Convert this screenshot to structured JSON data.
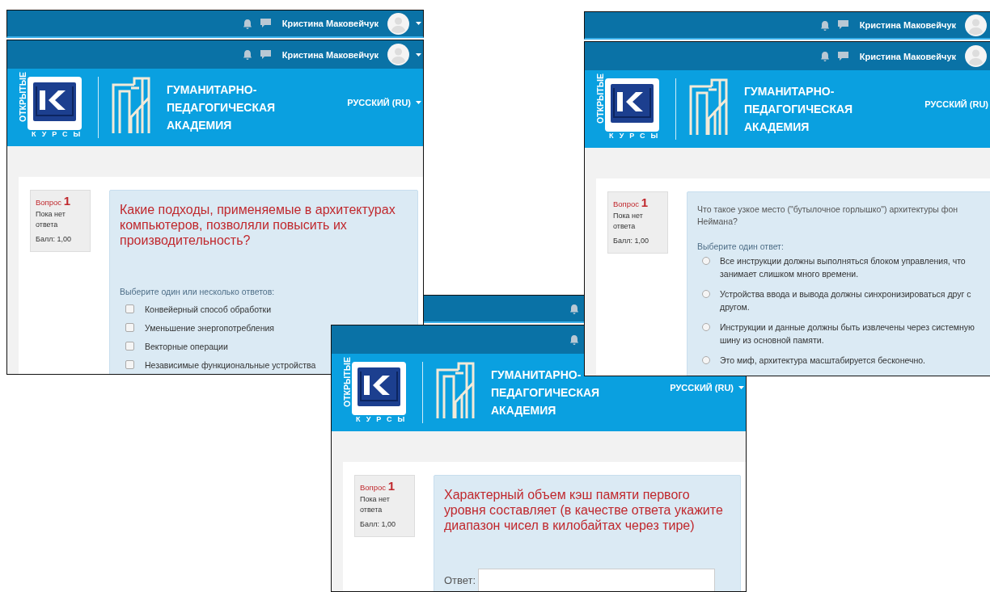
{
  "windows": [
    {
      "back_bar": {
        "user": "Кристина Маковейчук"
      },
      "top_bar": {
        "user": "Кристина Маковейчук"
      },
      "logo": {
        "vertical_word": "ОТКРЫТЫЕ",
        "bottom_word": "КУРСЫ"
      },
      "academy": [
        "ГУМАНИТАРНО-",
        "ПЕДАГОГИЧЕСКАЯ",
        "АКАДЕМИЯ"
      ],
      "language": "РУССКИЙ (RU)",
      "info": {
        "label": "Вопрос",
        "number": "1",
        "state": "Пока нет ответа",
        "grade": "Балл: 1,00"
      },
      "question": {
        "highlighted": true,
        "text": "Какие подходы, применяемые в архитектурах компьютеров, позволяли повысить их производительность?",
        "kind": "multi",
        "prompt": "Выберите один или несколько ответов:",
        "options": [
          {
            "label": "Конвейерный способ обработки",
            "checked": false
          },
          {
            "label": "Уменьшение энергопотребления",
            "checked": false
          },
          {
            "label": "Векторные операции",
            "checked": false
          },
          {
            "label": "Независимые функциональные устройства",
            "checked": false
          }
        ]
      }
    },
    {
      "back_bar": {
        "user": "Кристина Маковейчук"
      },
      "top_bar": {
        "user": "Кристина Маковейчук"
      },
      "logo": {
        "vertical_word": "ОТКРЫТЫЕ",
        "bottom_word": "КУРСЫ"
      },
      "academy": [
        "ГУМАНИТАРНО-",
        "ПЕДАГОГИЧЕСКАЯ",
        "АКАДЕМИЯ"
      ],
      "language": "РУССКИЙ (RU)",
      "info": {
        "label": "Вопрос",
        "number": "1",
        "state": "Пока нет ответа",
        "grade": "Балл: 1,00"
      },
      "question": {
        "highlighted": false,
        "text": "Что такое узкое место (\"бутылочное горлышко\") архитектуры фон Неймана?",
        "kind": "single",
        "prompt": "Выберите один ответ:",
        "options": [
          {
            "label": "Все инструкции должны выполняться блоком управления, что занимает слишком много времени.",
            "selected": false
          },
          {
            "label": "Устройства ввода и вывода должны синхронизироваться друг с другом.",
            "selected": false
          },
          {
            "label": "Инструкции и данные должны быть извлечены через системную шину из основной памяти.",
            "selected": false
          },
          {
            "label": "Это миф, архитектура масштабируется бесконечно.",
            "selected": false
          }
        ]
      }
    },
    {
      "logo": {
        "vertical_word": "ОТКРЫТЫЕ",
        "bottom_word": "КУРСЫ"
      },
      "academy": [
        "ГУМАНИТАРНО-",
        "ПЕДАГОГИЧЕСКАЯ",
        "АКАДЕМИЯ"
      ],
      "language": "РУССКИЙ (RU)",
      "info": {
        "label": "Вопрос",
        "number": "1",
        "state": "Пока нет ответа",
        "grade": "Балл: 1,00"
      },
      "question": {
        "highlighted": true,
        "text": "Характерный объем кэш памяти первого уровня составляет (в качестве ответа укажите диапазон чисел в килобайтах через тире)",
        "kind": "text",
        "answer_label": "Ответ:"
      }
    }
  ]
}
